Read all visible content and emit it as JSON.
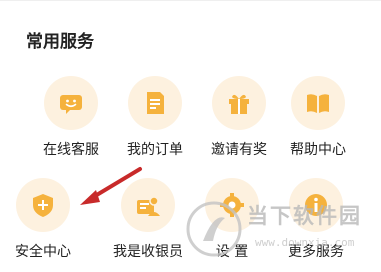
{
  "section": {
    "title": "常用服务"
  },
  "services": [
    {
      "label": "在线客服",
      "icon": "chat-bubble-icon"
    },
    {
      "label": "我的订单",
      "icon": "order-document-icon"
    },
    {
      "label": "邀请有奖",
      "icon": "gift-box-icon"
    },
    {
      "label": "帮助中心",
      "icon": "book-icon"
    },
    {
      "label": "安全中心",
      "icon": "shield-icon"
    },
    {
      "label": "我是收银员",
      "icon": "cashier-icon"
    },
    {
      "label": "设 置",
      "icon": "gear-icon"
    },
    {
      "label": "更多服务",
      "icon": "info-icon"
    }
  ],
  "colors": {
    "icon_bg": "#fdf1df",
    "icon_fg": "#f5b23d",
    "arrow": "#c82a2a"
  },
  "watermark": {
    "brand": "当下软件园",
    "url": "www.downxia.com"
  }
}
